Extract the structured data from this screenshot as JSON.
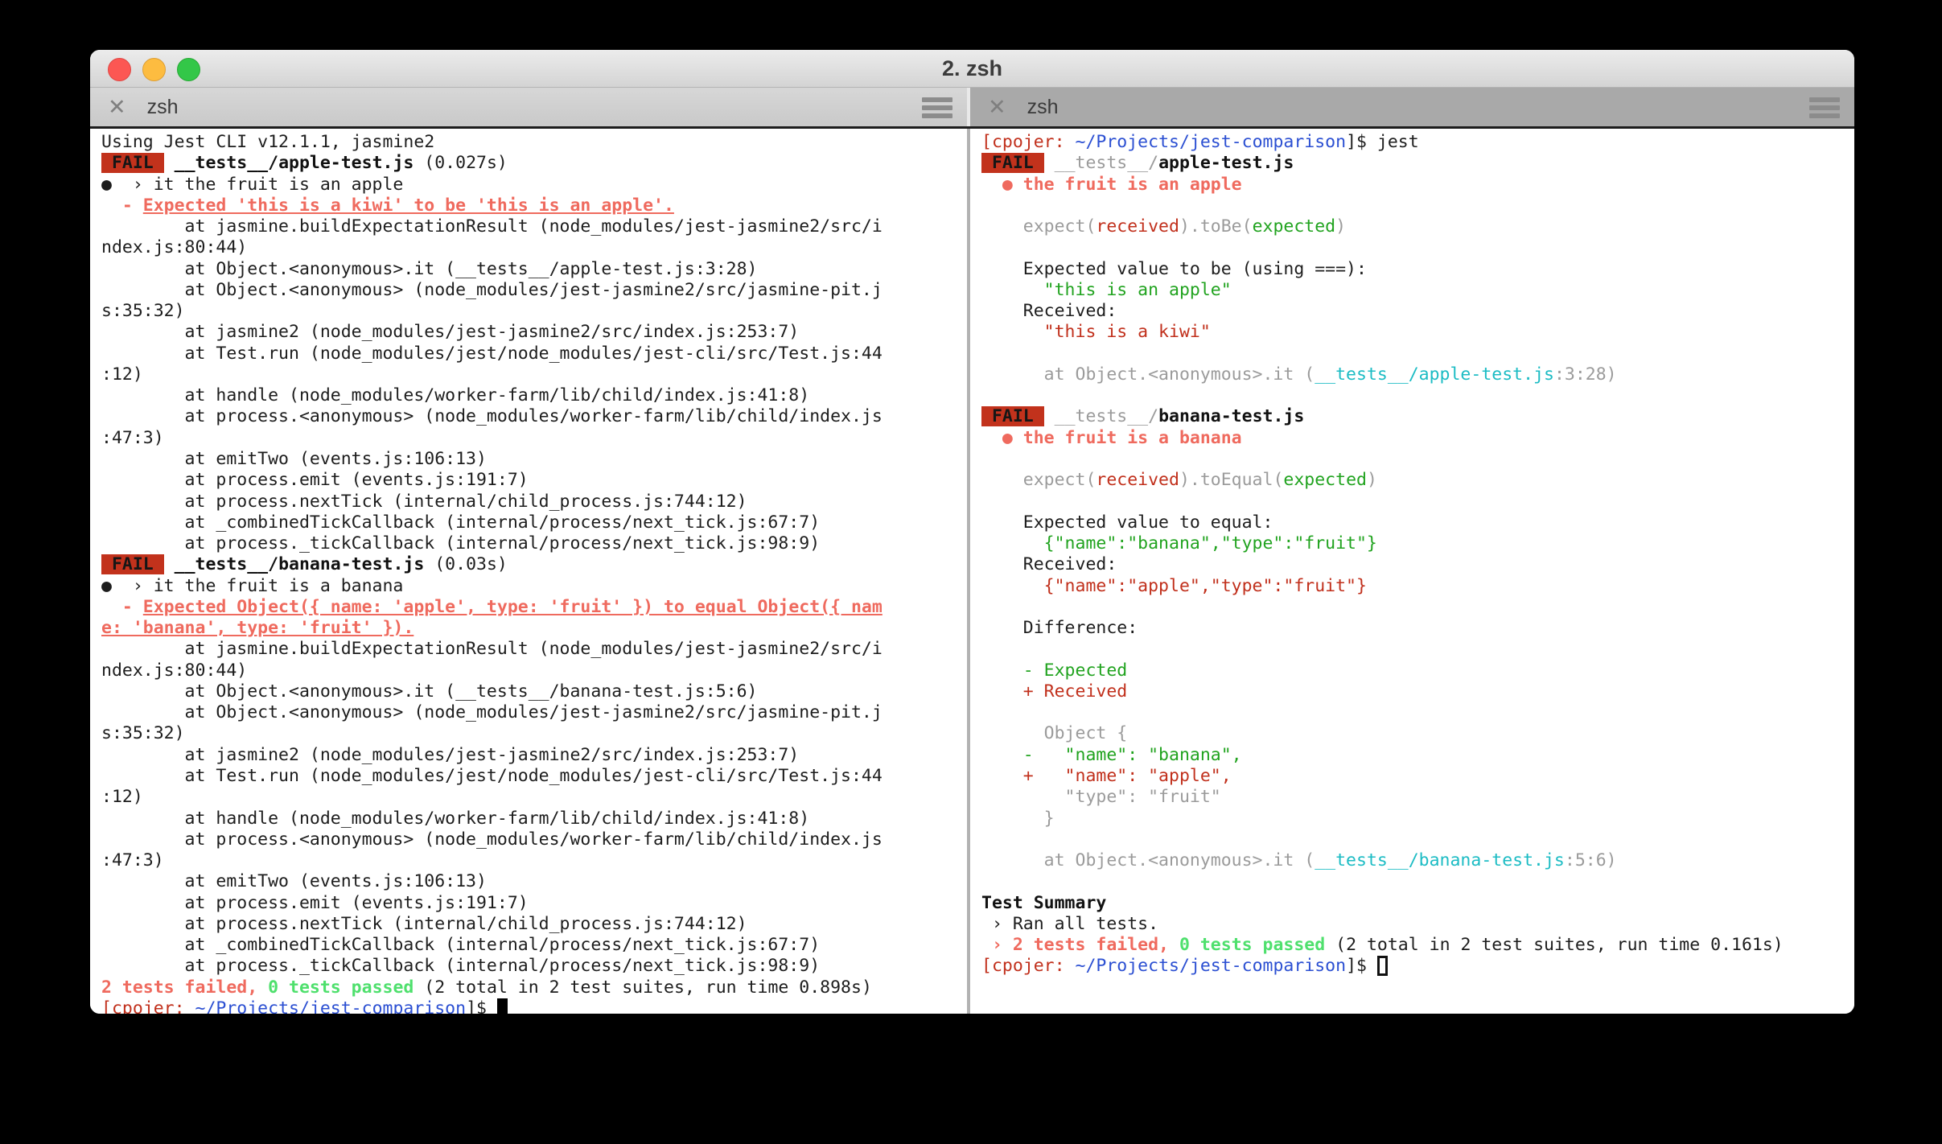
{
  "window": {
    "title": "2. zsh"
  },
  "icons": {
    "close": "✕",
    "menu": "hamburger-icon"
  },
  "tabs": {
    "left": {
      "label": "zsh"
    },
    "right": {
      "label": "zsh"
    }
  },
  "colors": {
    "fail_badge_bg": "#c2321c",
    "salmon_red": "#ef6a5e",
    "dark_red": "#c1301c",
    "green": "#21a31f",
    "bright_green": "#4fe06d",
    "dim_gray": "#9b9b9b",
    "cyan": "#1cbcc4",
    "blue": "#2b4fd2"
  },
  "left_terminal": {
    "lines": [
      [
        {
          "c": "k",
          "t": "Using Jest CLI v12.1.1, jasmine2"
        }
      ],
      [
        {
          "c": "badge",
          "t": " FAIL "
        },
        {
          "c": "k",
          "t": " "
        },
        {
          "c": "b",
          "t": "__tests__/apple-test.js"
        },
        {
          "c": "k",
          "t": " (0.027s)"
        }
      ],
      [
        {
          "c": "k",
          "t": "●  › it the fruit is an apple"
        }
      ],
      [
        {
          "c": "sal",
          "t": "  - "
        },
        {
          "c": "salu",
          "t": "Expected 'this is a kiwi' to be 'this is an apple'."
        }
      ],
      [
        {
          "c": "k",
          "t": "        at jasmine.buildExpectationResult (node_modules/jest-jasmine2/src/i"
        }
      ],
      [
        {
          "c": "k",
          "t": "ndex.js:80:44)"
        }
      ],
      [
        {
          "c": "k",
          "t": "        at Object.<anonymous>.it (__tests__/apple-test.js:3:28)"
        }
      ],
      [
        {
          "c": "k",
          "t": "        at Object.<anonymous> (node_modules/jest-jasmine2/src/jasmine-pit.j"
        }
      ],
      [
        {
          "c": "k",
          "t": "s:35:32)"
        }
      ],
      [
        {
          "c": "k",
          "t": "        at jasmine2 (node_modules/jest-jasmine2/src/index.js:253:7)"
        }
      ],
      [
        {
          "c": "k",
          "t": "        at Test.run (node_modules/jest/node_modules/jest-cli/src/Test.js:44"
        }
      ],
      [
        {
          "c": "k",
          "t": ":12)"
        }
      ],
      [
        {
          "c": "k",
          "t": "        at handle (node_modules/worker-farm/lib/child/index.js:41:8)"
        }
      ],
      [
        {
          "c": "k",
          "t": "        at process.<anonymous> (node_modules/worker-farm/lib/child/index.js"
        }
      ],
      [
        {
          "c": "k",
          "t": ":47:3)"
        }
      ],
      [
        {
          "c": "k",
          "t": "        at emitTwo (events.js:106:13)"
        }
      ],
      [
        {
          "c": "k",
          "t": "        at process.emit (events.js:191:7)"
        }
      ],
      [
        {
          "c": "k",
          "t": "        at process.nextTick (internal/child_process.js:744:12)"
        }
      ],
      [
        {
          "c": "k",
          "t": "        at _combinedTickCallback (internal/process/next_tick.js:67:7)"
        }
      ],
      [
        {
          "c": "k",
          "t": "        at process._tickCallback (internal/process/next_tick.js:98:9)"
        }
      ],
      [
        {
          "c": "badge",
          "t": " FAIL "
        },
        {
          "c": "k",
          "t": " "
        },
        {
          "c": "b",
          "t": "__tests__/banana-test.js"
        },
        {
          "c": "k",
          "t": " (0.03s)"
        }
      ],
      [
        {
          "c": "k",
          "t": "●  › it the fruit is a banana"
        }
      ],
      [
        {
          "c": "sal",
          "t": "  - "
        },
        {
          "c": "salu",
          "t": "Expected Object({ name: 'apple', type: 'fruit' }) to equal Object({ nam"
        }
      ],
      [
        {
          "c": "salu",
          "t": "e: 'banana', type: 'fruit' })."
        }
      ],
      [
        {
          "c": "k",
          "t": "        at jasmine.buildExpectationResult (node_modules/jest-jasmine2/src/i"
        }
      ],
      [
        {
          "c": "k",
          "t": "ndex.js:80:44)"
        }
      ],
      [
        {
          "c": "k",
          "t": "        at Object.<anonymous>.it (__tests__/banana-test.js:5:6)"
        }
      ],
      [
        {
          "c": "k",
          "t": "        at Object.<anonymous> (node_modules/jest-jasmine2/src/jasmine-pit.j"
        }
      ],
      [
        {
          "c": "k",
          "t": "s:35:32)"
        }
      ],
      [
        {
          "c": "k",
          "t": "        at jasmine2 (node_modules/jest-jasmine2/src/index.js:253:7)"
        }
      ],
      [
        {
          "c": "k",
          "t": "        at Test.run (node_modules/jest/node_modules/jest-cli/src/Test.js:44"
        }
      ],
      [
        {
          "c": "k",
          "t": ":12)"
        }
      ],
      [
        {
          "c": "k",
          "t": "        at handle (node_modules/worker-farm/lib/child/index.js:41:8)"
        }
      ],
      [
        {
          "c": "k",
          "t": "        at process.<anonymous> (node_modules/worker-farm/lib/child/index.js"
        }
      ],
      [
        {
          "c": "k",
          "t": ":47:3)"
        }
      ],
      [
        {
          "c": "k",
          "t": "        at emitTwo (events.js:106:13)"
        }
      ],
      [
        {
          "c": "k",
          "t": "        at process.emit (events.js:191:7)"
        }
      ],
      [
        {
          "c": "k",
          "t": "        at process.nextTick (internal/child_process.js:744:12)"
        }
      ],
      [
        {
          "c": "k",
          "t": "        at _combinedTickCallback (internal/process/next_tick.js:67:7)"
        }
      ],
      [
        {
          "c": "k",
          "t": "        at process._tickCallback (internal/process/next_tick.js:98:9)"
        }
      ],
      [
        {
          "c": "sal",
          "t": "2 tests failed,"
        },
        {
          "c": "k",
          "t": " "
        },
        {
          "c": "bgrn",
          "t": "0 tests passed"
        },
        {
          "c": "k",
          "t": " (2 total in 2 test suites, run time 0.898s)"
        }
      ],
      [
        {
          "c": "dred",
          "t": "[cpojer:"
        },
        {
          "c": "k",
          "t": " "
        },
        {
          "c": "blue",
          "t": "~/Projects/jest-comparison"
        },
        {
          "c": "k",
          "t": "]$ "
        },
        {
          "c": "cs",
          "t": " "
        }
      ]
    ]
  },
  "right_terminal": {
    "lines": [
      [
        {
          "c": "dred",
          "t": "[cpojer:"
        },
        {
          "c": "k",
          "t": " "
        },
        {
          "c": "blue",
          "t": "~/Projects/jest-comparison"
        },
        {
          "c": "k",
          "t": "]$ jest"
        }
      ],
      [
        {
          "c": "badge",
          "t": " FAIL "
        },
        {
          "c": "k",
          "t": " "
        },
        {
          "c": "gray",
          "t": "__tests__/"
        },
        {
          "c": "b",
          "t": "apple-test.js"
        }
      ],
      [
        {
          "c": "sal",
          "t": "  ● "
        },
        {
          "c": "salb",
          "t": "the fruit is an apple"
        }
      ],
      [],
      [
        {
          "c": "k",
          "t": "    "
        },
        {
          "c": "gray",
          "t": "expect("
        },
        {
          "c": "dred",
          "t": "received"
        },
        {
          "c": "gray",
          "t": ").toBe("
        },
        {
          "c": "grn",
          "t": "expected"
        },
        {
          "c": "gray",
          "t": ")"
        }
      ],
      [],
      [
        {
          "c": "k",
          "t": "    Expected value to be (using ===):"
        }
      ],
      [
        {
          "c": "grn",
          "t": "      \"this is an apple\""
        }
      ],
      [
        {
          "c": "k",
          "t": "    Received:"
        }
      ],
      [
        {
          "c": "dred",
          "t": "      \"this is a kiwi\""
        }
      ],
      [],
      [
        {
          "c": "gray",
          "t": "      at Object.<anonymous>.it ("
        },
        {
          "c": "cyan",
          "t": "__tests__/apple-test.js"
        },
        {
          "c": "gray",
          "t": ":3:28)"
        }
      ],
      [],
      [
        {
          "c": "badge",
          "t": " FAIL "
        },
        {
          "c": "k",
          "t": " "
        },
        {
          "c": "gray",
          "t": "__tests__/"
        },
        {
          "c": "b",
          "t": "banana-test.js"
        }
      ],
      [
        {
          "c": "sal",
          "t": "  ● "
        },
        {
          "c": "salb",
          "t": "the fruit is a banana"
        }
      ],
      [],
      [
        {
          "c": "k",
          "t": "    "
        },
        {
          "c": "gray",
          "t": "expect("
        },
        {
          "c": "dred",
          "t": "received"
        },
        {
          "c": "gray",
          "t": ").toEqual("
        },
        {
          "c": "grn",
          "t": "expected"
        },
        {
          "c": "gray",
          "t": ")"
        }
      ],
      [],
      [
        {
          "c": "k",
          "t": "    Expected value to equal:"
        }
      ],
      [
        {
          "c": "grn",
          "t": "      {\"name\":\"banana\",\"type\":\"fruit\"}"
        }
      ],
      [
        {
          "c": "k",
          "t": "    Received:"
        }
      ],
      [
        {
          "c": "dred",
          "t": "      {\"name\":\"apple\",\"type\":\"fruit\"}"
        }
      ],
      [],
      [
        {
          "c": "k",
          "t": "    Difference:"
        }
      ],
      [],
      [
        {
          "c": "grn",
          "t": "    - Expected"
        }
      ],
      [
        {
          "c": "dred",
          "t": "    + Received"
        }
      ],
      [],
      [
        {
          "c": "gray",
          "t": "      Object {"
        }
      ],
      [
        {
          "c": "grn",
          "t": "    -   \"name\": \"banana\","
        }
      ],
      [
        {
          "c": "dred",
          "t": "    +   \"name\": \"apple\","
        }
      ],
      [
        {
          "c": "gray",
          "t": "        \"type\": \"fruit\""
        }
      ],
      [
        {
          "c": "gray",
          "t": "      }"
        }
      ],
      [],
      [
        {
          "c": "gray",
          "t": "      at Object.<anonymous>.it ("
        },
        {
          "c": "cyan",
          "t": "__tests__/banana-test.js"
        },
        {
          "c": "gray",
          "t": ":5:6)"
        }
      ],
      [],
      [
        {
          "c": "b",
          "t": "Test Summary"
        }
      ],
      [
        {
          "c": "k",
          "t": " › Ran all tests."
        }
      ],
      [
        {
          "c": "k",
          "t": " "
        },
        {
          "c": "sal",
          "t": "› "
        },
        {
          "c": "salb",
          "t": "2 tests failed,"
        },
        {
          "c": "k",
          "t": " "
        },
        {
          "c": "bgrn",
          "t": "0 tests passed"
        },
        {
          "c": "k",
          "t": " (2 total in 2 test suites, run time 0.161s)"
        }
      ],
      [
        {
          "c": "dred",
          "t": "[cpojer:"
        },
        {
          "c": "k",
          "t": " "
        },
        {
          "c": "blue",
          "t": "~/Projects/jest-comparison"
        },
        {
          "c": "k",
          "t": "]$ "
        },
        {
          "c": "ch",
          "t": " "
        }
      ]
    ]
  }
}
